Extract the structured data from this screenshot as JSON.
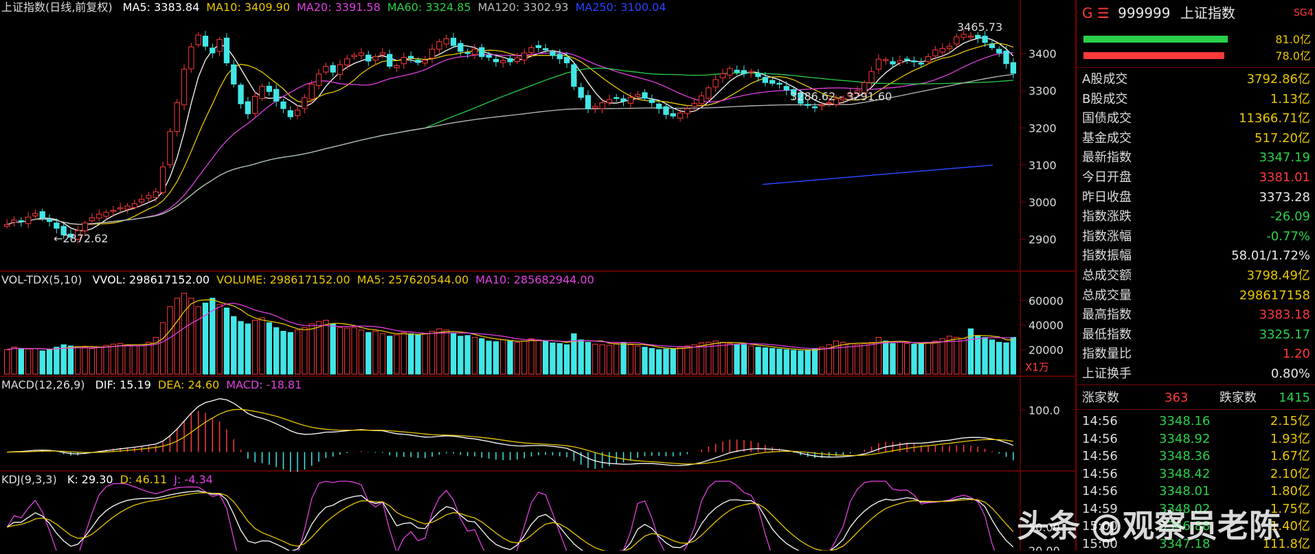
{
  "chart_data": [
    {
      "type": "candlestick",
      "title": "上证指数(日线,前复权)",
      "ylim": [
        2820,
        3500
      ],
      "yticks": [
        2900,
        3000,
        3100,
        3200,
        3300,
        3400
      ],
      "ma_legend": [
        {
          "label": "MA5:",
          "value": "3383.84",
          "color": "#ffffff"
        },
        {
          "label": "MA10:",
          "value": "3409.90",
          "color": "#e8c700"
        },
        {
          "label": "MA20:",
          "value": "3391.58",
          "color": "#e040e0"
        },
        {
          "label": "MA60:",
          "value": "3324.85",
          "color": "#2ad04a"
        },
        {
          "label": "MA120:",
          "value": "3302.93",
          "color": "#bbbbbb"
        },
        {
          "label": "MA250:",
          "value": "3100.04",
          "color": "#2a44ff"
        }
      ],
      "annotations": {
        "high": "3465.73",
        "low": "2872.62",
        "range": "3286.62 - 3291.60"
      },
      "closes": [
        2940,
        2952,
        2948,
        2960,
        2970,
        2958,
        2948,
        2930,
        2912,
        2906,
        2924,
        2944,
        2958,
        2968,
        2973,
        2978,
        2985,
        2990,
        2996,
        3008,
        3018,
        3028,
        3095,
        3190,
        3268,
        3358,
        3418,
        3450,
        3420,
        3402,
        3438,
        3375,
        3318,
        3265,
        3238,
        3285,
        3312,
        3298,
        3272,
        3252,
        3230,
        3248,
        3282,
        3318,
        3345,
        3366,
        3350,
        3370,
        3386,
        3396,
        3402,
        3380,
        3392,
        3402,
        3366,
        3368,
        3390,
        3388,
        3376,
        3382,
        3412,
        3432,
        3440,
        3422,
        3406,
        3402,
        3412,
        3392,
        3390,
        3378,
        3381,
        3378,
        3389,
        3402,
        3416,
        3416,
        3410,
        3395,
        3386,
        3375,
        3312,
        3282,
        3252,
        3258,
        3268,
        3276,
        3280,
        3272,
        3282,
        3290,
        3280,
        3268,
        3252,
        3236,
        3232,
        3240,
        3252,
        3266,
        3286,
        3308,
        3330,
        3346,
        3360,
        3350,
        3346,
        3352,
        3338,
        3322,
        3320,
        3318,
        3302,
        3288,
        3266,
        3262,
        3256,
        3262,
        3268,
        3278,
        3280,
        3292,
        3300,
        3322,
        3352,
        3385,
        3384,
        3372,
        3381,
        3385,
        3378,
        3373,
        3392,
        3410,
        3414,
        3420,
        3445,
        3452,
        3447,
        3442,
        3430,
        3416,
        3402,
        3373,
        3347
      ]
    },
    {
      "type": "bar",
      "title": "VOL-TDX(5,10)",
      "unit_label": "X1万",
      "ylim": [
        0,
        70000
      ],
      "yticks": [
        20000,
        40000,
        60000
      ],
      "legend": [
        {
          "label": "VVOL:",
          "value": "298617152.00",
          "color": "#ffffff"
        },
        {
          "label": "VOLUME:",
          "value": "298617152.00",
          "color": "#e8c700"
        },
        {
          "label": "MA5:",
          "value": "257620544.00",
          "color": "#e8c700"
        },
        {
          "label": "MA10:",
          "value": "285682944.00",
          "color": "#e040e0"
        }
      ],
      "values": [
        20000,
        22000,
        21000,
        20500,
        21000,
        19000,
        20000,
        22000,
        24000,
        23000,
        22500,
        22000,
        21000,
        22000,
        23500,
        24500,
        25000,
        24000,
        23000,
        24000,
        26000,
        30000,
        42000,
        55000,
        62000,
        66000,
        62000,
        55000,
        58000,
        62000,
        57000,
        54000,
        47000,
        43000,
        41000,
        44000,
        46000,
        42000,
        38000,
        35000,
        34000,
        36000,
        38000,
        41000,
        43000,
        44000,
        41000,
        38000,
        37500,
        38000,
        36000,
        34000,
        35000,
        33000,
        31000,
        32000,
        34000,
        33000,
        32000,
        33000,
        35000,
        37000,
        36000,
        33000,
        31000,
        31500,
        30000,
        29000,
        27000,
        26500,
        28000,
        27000,
        26000,
        27000,
        29000,
        28000,
        27000,
        25500,
        25000,
        24000,
        33000,
        28000,
        26000,
        24500,
        24000,
        23500,
        25000,
        26000,
        24000,
        23000,
        22000,
        21000,
        20000,
        20500,
        21000,
        22000,
        23000,
        24000,
        25500,
        26000,
        27000,
        26000,
        25000,
        24500,
        24000,
        23000,
        22000,
        21500,
        21000,
        20500,
        20000,
        19500,
        19000,
        20000,
        21000,
        22000,
        24000,
        27000,
        26000,
        25000,
        24000,
        25000,
        26000,
        30000,
        27000,
        25000,
        26000,
        25000,
        24500,
        25000,
        26000,
        27000,
        29000,
        31000,
        30000,
        29000,
        37000,
        31000,
        30000,
        28000,
        26000,
        25500,
        30000
      ]
    },
    {
      "type": "line",
      "title": "MACD(12,26,9)",
      "ylim": [
        -40,
        140
      ],
      "yticks": [
        100.0
      ],
      "legend": [
        {
          "label": "DIF:",
          "value": "15.19",
          "color": "#ffffff"
        },
        {
          "label": "DEA:",
          "value": "24.60",
          "color": "#e8c700"
        },
        {
          "label": "MACD:",
          "value": "-18.81",
          "color": "#e040e0"
        }
      ]
    },
    {
      "type": "line",
      "title": "KDJ(9,3,3)",
      "ylim": [
        20,
        100
      ],
      "yticks": [
        50.0,
        20.0
      ],
      "legend": [
        {
          "label": "K:",
          "value": "29.30",
          "color": "#ffffff"
        },
        {
          "label": "D:",
          "value": "46.11",
          "color": "#e8c700"
        },
        {
          "label": "J:",
          "value": "-4.34",
          "color": "#e040e0"
        }
      ]
    }
  ],
  "side": {
    "prefix": "G ☰",
    "code": "999999",
    "name": "上证指数",
    "tag": "SG4",
    "bar1": "81.0亿",
    "bar2": "78.0亿",
    "rows": [
      {
        "label": "A股成交",
        "value": "3792.86亿",
        "color": "yellow"
      },
      {
        "label": "B股成交",
        "value": "1.13亿",
        "color": "yellow"
      },
      {
        "label": "国债成交",
        "value": "11366.71亿",
        "color": "yellow"
      },
      {
        "label": "基金成交",
        "value": "517.20亿",
        "color": "yellow"
      },
      {
        "label": "最新指数",
        "value": "3347.19",
        "color": "green"
      },
      {
        "label": "今日开盘",
        "value": "3381.01",
        "color": "red"
      },
      {
        "label": "昨日收盘",
        "value": "3373.28",
        "color": "white"
      },
      {
        "label": "指数涨跌",
        "value": "-26.09",
        "color": "green"
      },
      {
        "label": "指数涨幅",
        "value": "-0.77%",
        "color": "green"
      },
      {
        "label": "指数振幅",
        "value": "58.01/1.72%",
        "color": "white"
      },
      {
        "label": "总成交额",
        "value": "3798.49亿",
        "color": "yellow"
      },
      {
        "label": "总成交量",
        "value": "298617158",
        "color": "yellow"
      },
      {
        "label": "最高指数",
        "value": "3383.18",
        "color": "red"
      },
      {
        "label": "最低指数",
        "value": "3325.17",
        "color": "green"
      },
      {
        "label": "指数量比",
        "value": "1.20",
        "color": "red"
      },
      {
        "label": "上证换手",
        "value": "0.80%",
        "color": "white"
      }
    ],
    "up_label": "涨家数",
    "up_value": "363",
    "down_label": "跌家数",
    "down_value": "1415",
    "ticks": [
      {
        "time": "14:56",
        "price": "3348.16",
        "vol": "2.15亿"
      },
      {
        "time": "14:56",
        "price": "3348.92",
        "vol": "1.93亿"
      },
      {
        "time": "14:56",
        "price": "3348.36",
        "vol": "1.67亿"
      },
      {
        "time": "14:56",
        "price": "3348.42",
        "vol": "2.10亿"
      },
      {
        "time": "14:56",
        "price": "3348.01",
        "vol": "1.80亿"
      },
      {
        "time": "14:59",
        "price": "3348.02",
        "vol": "1.75亿"
      },
      {
        "time": "15:00",
        "price": "3346.88",
        "vol": "1.40亿"
      },
      {
        "time": "15:00",
        "price": "3347.18",
        "vol": "111.8亿"
      }
    ]
  },
  "watermark": "头条 @观察员老陈"
}
